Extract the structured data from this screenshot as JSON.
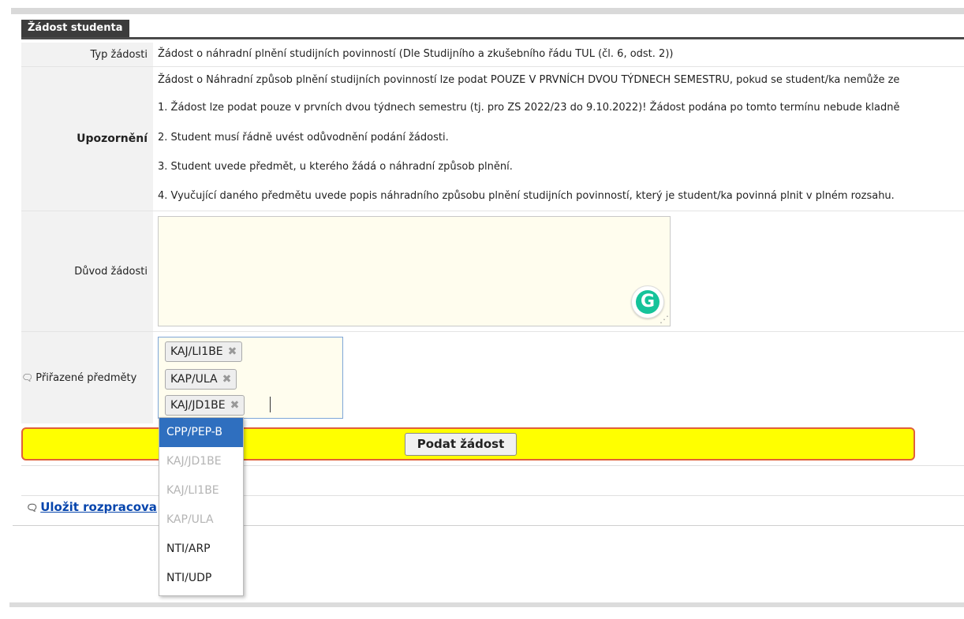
{
  "header": {
    "title": "Žádost studenta"
  },
  "type_row": {
    "label": "Typ žádosti",
    "value": "Žádost o náhradní plnění studijních povinností (Dle Studijního a zkušebního řádu TUL (čl. 6, odst. 2))"
  },
  "warning": {
    "label": "Upozornění",
    "lines": [
      "Žádost o Náhradní způsob plnění studijních povinností lze podat POUZE V PRVNÍCH DVOU TÝDNECH SEMESTRU, pokud se student/ka nemůže ze",
      "1. Žádost lze podat pouze v prvních dvou týdnech semestru (tj. pro ZS 2022/23 do 9.10.2022)! Žádost podána po tomto termínu nebude kladně",
      "2. Student musí řádně uvést odůvodnění podání žádosti.",
      "3. Student uvede předmět, u kterého žádá o náhradní způsob plnění.",
      "4. Vyučující daného předmětu uvede popis náhradního způsobu plnění studijních povinností, který je student/ka povinná plnit v plném rozsahu."
    ]
  },
  "reason": {
    "label": "Důvod žádosti",
    "value": "",
    "grammarly_glyph": "G"
  },
  "subjects": {
    "label": "Přiřazené předměty",
    "chips": [
      "KAJ/LI1BE",
      "KAP/ULA",
      "KAJ/JD1BE"
    ],
    "remove_glyph": "✖",
    "dropdown_options": [
      {
        "label": "CPP/PEP-B",
        "state": "highlighted"
      },
      {
        "label": "KAJ/JD1BE",
        "state": "disabled"
      },
      {
        "label": "KAJ/LI1BE",
        "state": "disabled"
      },
      {
        "label": "KAP/ULA",
        "state": "disabled"
      },
      {
        "label": "NTI/ARP",
        "state": "normal"
      },
      {
        "label": "NTI/UDP",
        "state": "normal"
      }
    ]
  },
  "actions": {
    "submit_label": "Podat žádost",
    "save_label": "Uložit rozpracova"
  },
  "icons": {
    "help": "help-bubble-icon"
  },
  "colors": {
    "submit_bar": "#ffff00",
    "submit_border": "#e0603a",
    "highlight": "#2f6fbf",
    "link": "#0645ad"
  }
}
